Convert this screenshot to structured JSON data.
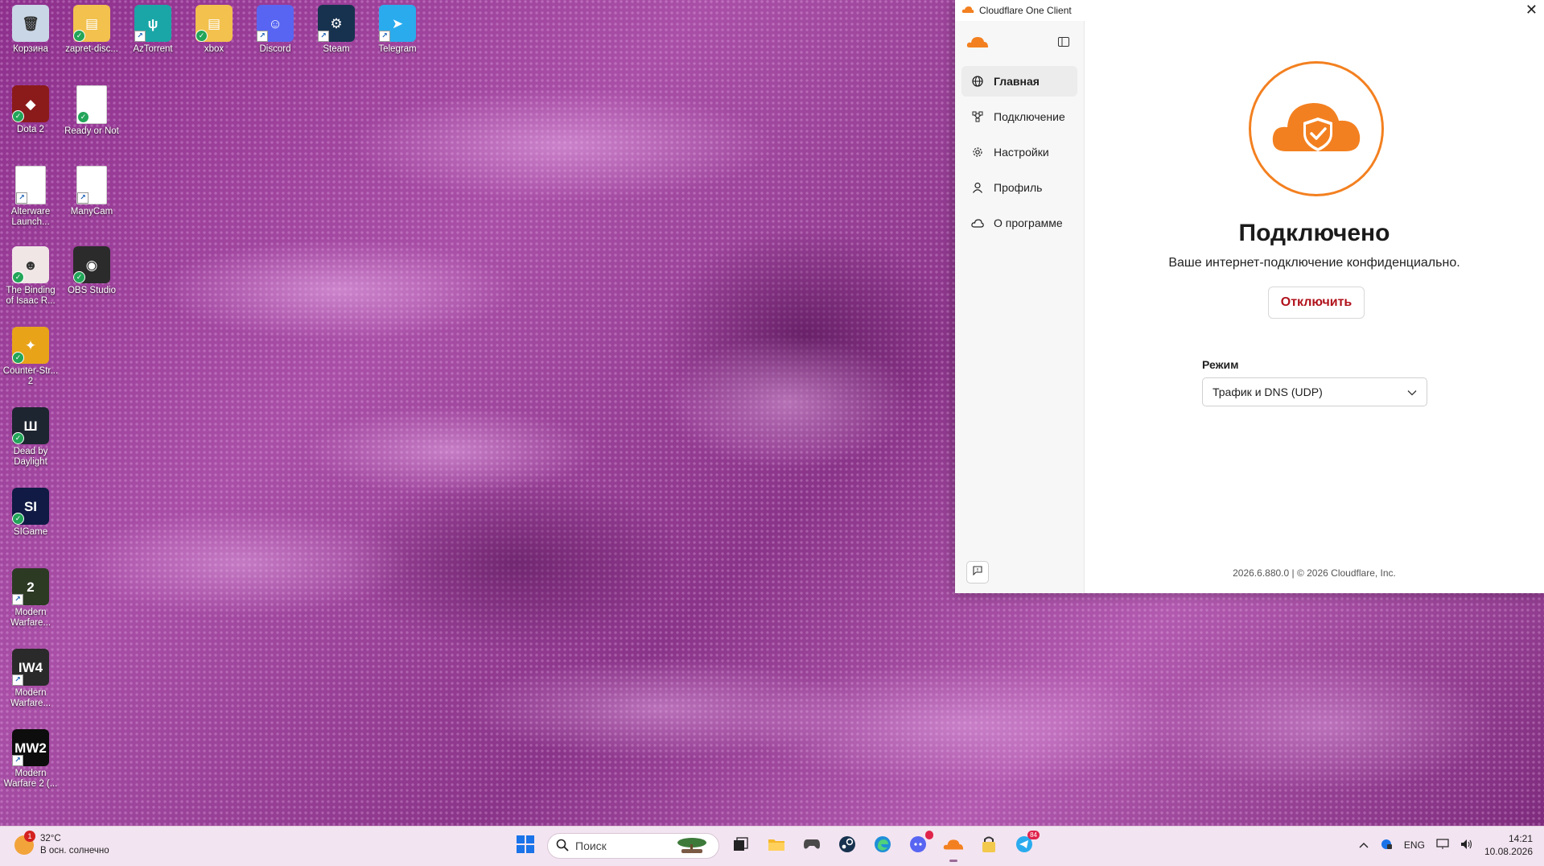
{
  "desktop": {
    "icons": [
      {
        "label": "Корзина",
        "glyph": "🗑",
        "color": "#c9d6e6"
      },
      {
        "label": "zapret-disc...",
        "glyph": "▤",
        "color": "#f2c14e"
      },
      {
        "label": "AzTorrent",
        "glyph": "ψ",
        "color": "#1aa6a6"
      },
      {
        "label": "xbox",
        "glyph": "▤",
        "color": "#f2c14e"
      },
      {
        "label": "Discord",
        "glyph": "☺",
        "color": "#5865f2"
      },
      {
        "label": "Steam",
        "glyph": "⚙",
        "color": "#17324f"
      },
      {
        "label": "Telegram",
        "glyph": "➤",
        "color": "#2aabee"
      },
      {
        "label": "Dota 2",
        "glyph": "◆",
        "color": "#8b1a1a"
      },
      {
        "label": "Ready or Not",
        "glyph": "",
        "color": "#ffffff"
      },
      {
        "label": "Alterware Launch...",
        "glyph": "",
        "color": "#ffffff"
      },
      {
        "label": "ManyCam",
        "glyph": "",
        "color": "#ffffff"
      },
      {
        "label": "The Binding of Isaac R...",
        "glyph": "☻",
        "color": "#f0e6e6"
      },
      {
        "label": "OBS Studio",
        "glyph": "◉",
        "color": "#2b2b2b"
      },
      {
        "label": "Counter-Str... 2",
        "glyph": "✦",
        "color": "#e8a319"
      },
      {
        "label": "Dead by Daylight",
        "glyph": "Ш",
        "color": "#1d2530"
      },
      {
        "label": "SIGame",
        "glyph": "SI",
        "color": "#101a44"
      },
      {
        "label": "Modern Warfare...",
        "glyph": "2",
        "color": "#2c3a24"
      },
      {
        "label": "Modern Warfare...",
        "glyph": "IW4",
        "color": "#2a2a2a"
      },
      {
        "label": "Modern Warfare 2 (...",
        "glyph": "MW2",
        "color": "#0d0d0d"
      }
    ]
  },
  "window": {
    "title": "Cloudflare One Client",
    "close_glyph": "✕",
    "sidebar": {
      "items": [
        {
          "label": "Главная",
          "icon": "globe-icon"
        },
        {
          "label": "Подключение",
          "icon": "network-icon"
        },
        {
          "label": "Настройки",
          "icon": "gear-icon"
        },
        {
          "label": "Профиль",
          "icon": "user-icon"
        },
        {
          "label": "О программе",
          "icon": "cloud-icon"
        }
      ]
    },
    "main": {
      "status_title": "Подключено",
      "status_subtitle": "Ваше интернет-подключение конфиденциально.",
      "disconnect_label": "Отключить",
      "mode_label": "Режим",
      "mode_value": "Трафик и DNS (UDP)",
      "footer": "2026.6.880.0  |  © 2026 Cloudflare, Inc."
    },
    "accent": "#f38020"
  },
  "taskbar": {
    "weather": {
      "temp": "32°C",
      "desc": "В осн. солнечно",
      "badge": "1"
    },
    "search_placeholder": "Поиск",
    "telegram_badge": "84",
    "lang": "ENG",
    "time": "14:21",
    "date": "10.08.2026"
  }
}
